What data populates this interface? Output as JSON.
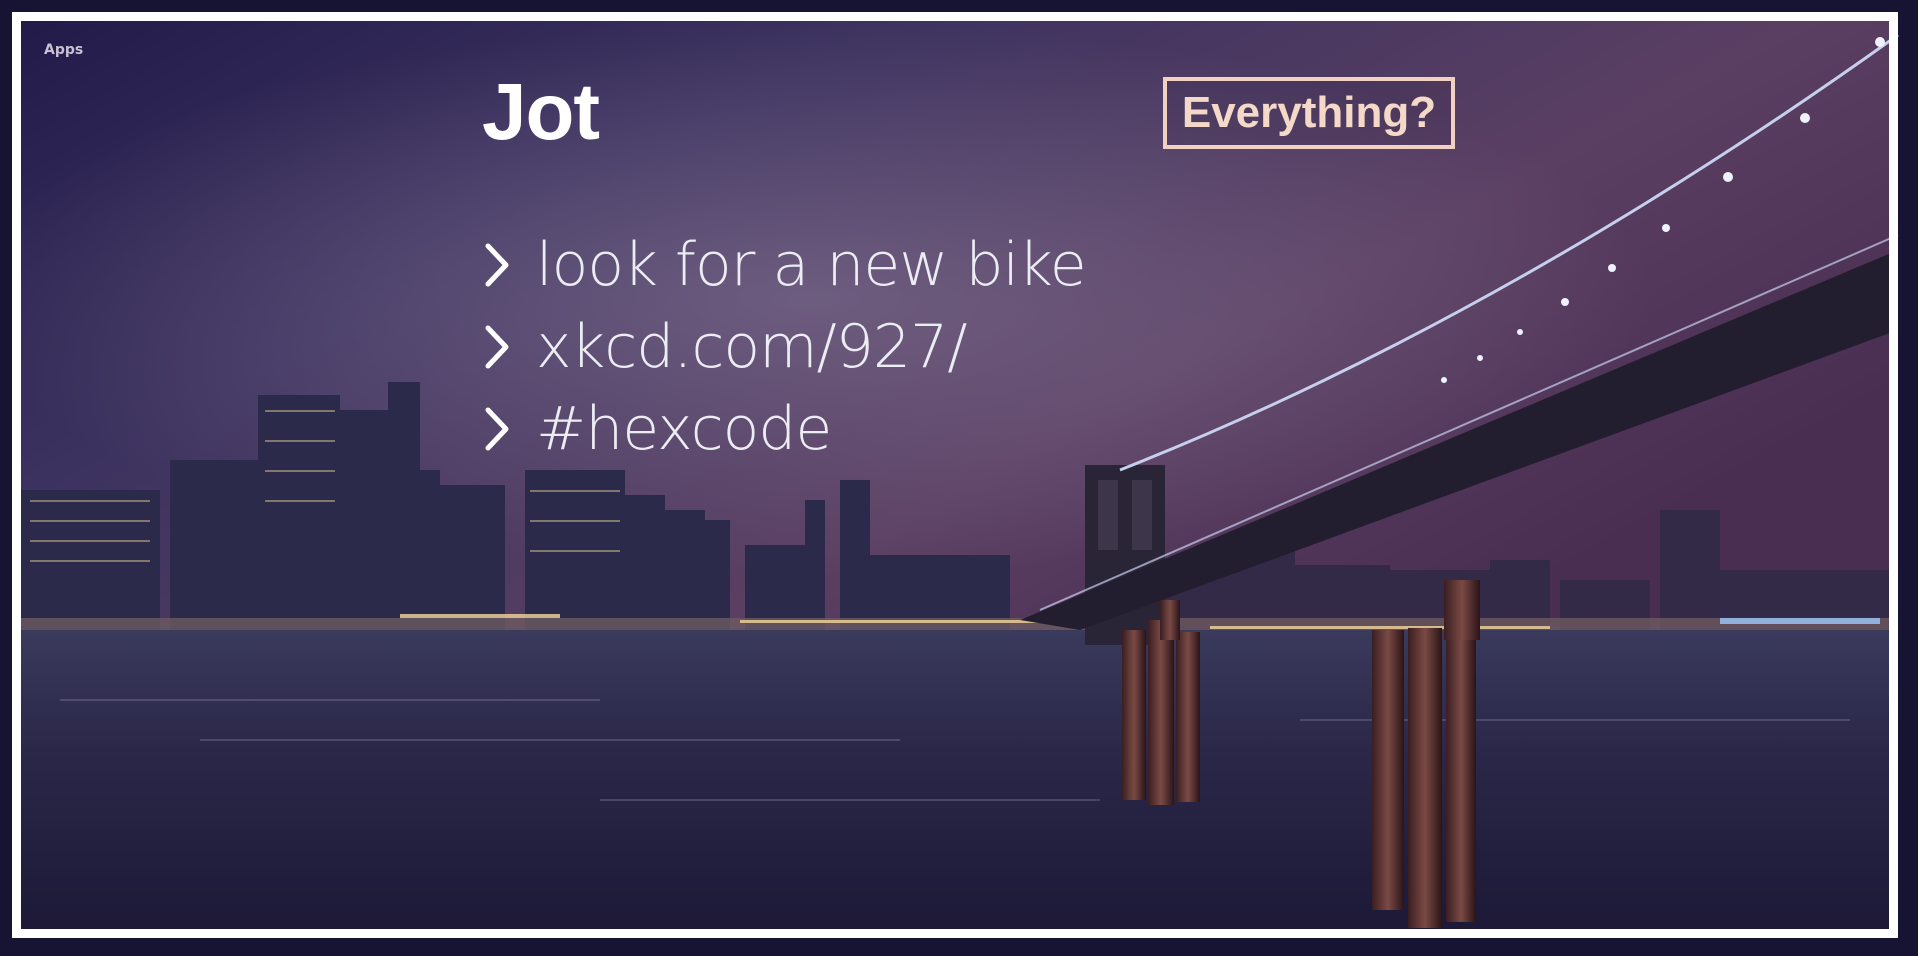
{
  "nav": {
    "apps_label": "Apps"
  },
  "app": {
    "title": "Jot"
  },
  "toggle": {
    "label": "Everything?"
  },
  "notes": [
    {
      "text": "look for a new bike",
      "icon": "chevron-right-icon"
    },
    {
      "text": "xkcd.com/927/",
      "icon": "chevron-right-icon"
    },
    {
      "text": "#hexcode",
      "icon": "chevron-right-icon"
    }
  ],
  "colors": {
    "frame": "#ffffff",
    "title": "#ffffff",
    "toggle_border": "#f1d2c2",
    "note_text": "#ececf3"
  }
}
